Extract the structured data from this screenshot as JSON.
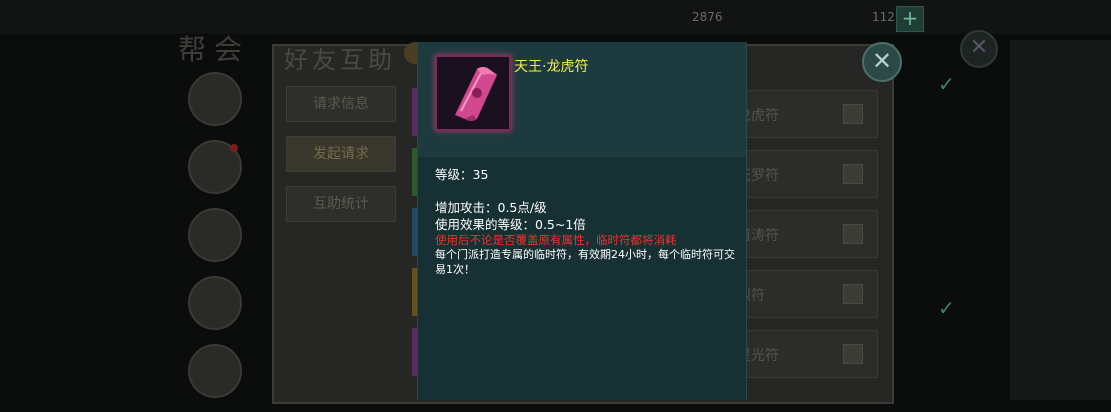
{
  "top_bar": {
    "resource_1": "2876",
    "resource_2": "112",
    "plus_label": "+"
  },
  "background": {
    "guild_title": "帮会",
    "panel_title": "好友互助",
    "tabs": [
      "请求信息",
      "发起请求",
      "互助统计"
    ],
    "active_tab": "发起请求",
    "list_rows": [
      "龙虎符",
      "天罗符",
      "清涛符",
      "烈符",
      "星光符"
    ],
    "close_label": "✕"
  },
  "tooltip": {
    "item_name": "天王·龙虎符",
    "level": "等级：35",
    "attr_1": "增加攻击：0.5点/级",
    "attr_2": "使用效果的等级：0.5~1倍",
    "warning": "使用后不论是否覆盖原有属性，临时符都将消耗",
    "description": "每个门派打造专属的临时符，有效期24小时，每个临时符可交易1次！"
  },
  "colors": {
    "item_name": "#f2ef4a",
    "warning": "#f0322a",
    "tooltip_bg": "#173033"
  }
}
